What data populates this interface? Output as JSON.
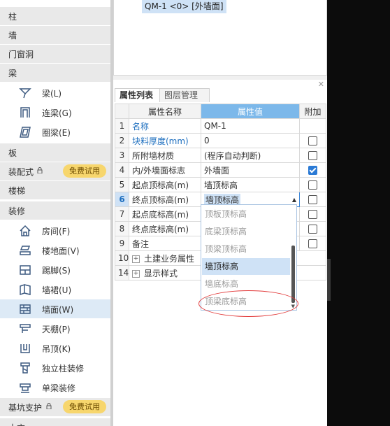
{
  "sidebar": {
    "categories": [
      {
        "label": "柱"
      },
      {
        "label": "墙"
      },
      {
        "label": "门窗洞"
      },
      {
        "label": "梁"
      },
      {
        "label": "板"
      },
      {
        "label": "装配式",
        "badge": "免费试用"
      },
      {
        "label": "楼梯"
      },
      {
        "label": "装修"
      },
      {
        "label": "基坑支护",
        "badge": "免费试用"
      },
      {
        "label": "土方"
      }
    ],
    "beam_items": [
      {
        "label": "梁(L)",
        "icon": "beam-icon"
      },
      {
        "label": "连梁(G)",
        "icon": "coupling-beam-icon"
      },
      {
        "label": "圈梁(E)",
        "icon": "ring-beam-icon"
      }
    ],
    "deco_items": [
      {
        "label": "房间(F)",
        "icon": "room-icon"
      },
      {
        "label": "楼地面(V)",
        "icon": "floor-icon"
      },
      {
        "label": "踢脚(S)",
        "icon": "skirting-icon"
      },
      {
        "label": "墙裙(U)",
        "icon": "dado-icon"
      },
      {
        "label": "墙面(W)",
        "icon": "wall-surface-icon",
        "active": true
      },
      {
        "label": "天棚(P)",
        "icon": "ceiling-icon"
      },
      {
        "label": "吊顶(K)",
        "icon": "suspended-ceiling-icon"
      },
      {
        "label": "独立柱装修",
        "icon": "column-deco-icon"
      },
      {
        "label": "单梁装修",
        "icon": "beam-deco-icon"
      }
    ]
  },
  "top_panel": {
    "selected_node": "QM-1 <0> [外墙面]"
  },
  "prop_panel": {
    "tabs": [
      "属性列表",
      "图层管理"
    ],
    "headers": {
      "name": "属性名称",
      "value": "属性值",
      "extra": "附加"
    },
    "rows": [
      {
        "num": "1",
        "name": "名称",
        "value": "QM-1",
        "blue": true,
        "check": "none"
      },
      {
        "num": "2",
        "name": "块料厚度(mm)",
        "value": "0",
        "blue": true,
        "check": "off"
      },
      {
        "num": "3",
        "name": "所附墙材质",
        "value": "(程序自动判断)",
        "check": "off"
      },
      {
        "num": "4",
        "name": "内/外墙面标志",
        "value": "外墙面",
        "check": "on"
      },
      {
        "num": "5",
        "name": "起点顶标高(m)",
        "value": "墙顶标高",
        "check": "off"
      },
      {
        "num": "6",
        "name": "终点顶标高(m)",
        "value": "墙顶标高",
        "check": "off",
        "current": true
      },
      {
        "num": "7",
        "name": "起点底标高(m)",
        "value": "",
        "check": "off"
      },
      {
        "num": "8",
        "name": "终点底标高(m)",
        "value": "",
        "check": "off"
      },
      {
        "num": "9",
        "name": "备注",
        "value": "",
        "check": "off"
      },
      {
        "num": "10",
        "name": "土建业务属性",
        "value": "",
        "expand": true,
        "check": "none"
      },
      {
        "num": "14",
        "name": "显示样式",
        "value": "",
        "expand": true,
        "check": "none"
      }
    ],
    "dropdown_options": [
      "顶板顶标高",
      "底梁顶标高",
      "顶梁顶标高",
      "墙顶标高",
      "墙底标高",
      "顶梁底标高"
    ],
    "dropdown_selected": "墙顶标高"
  },
  "colors": {
    "accent": "#7cb8ea",
    "selection": "#cfe2f6",
    "badge": "#f7d66d",
    "annotation": "#e23a3a"
  }
}
